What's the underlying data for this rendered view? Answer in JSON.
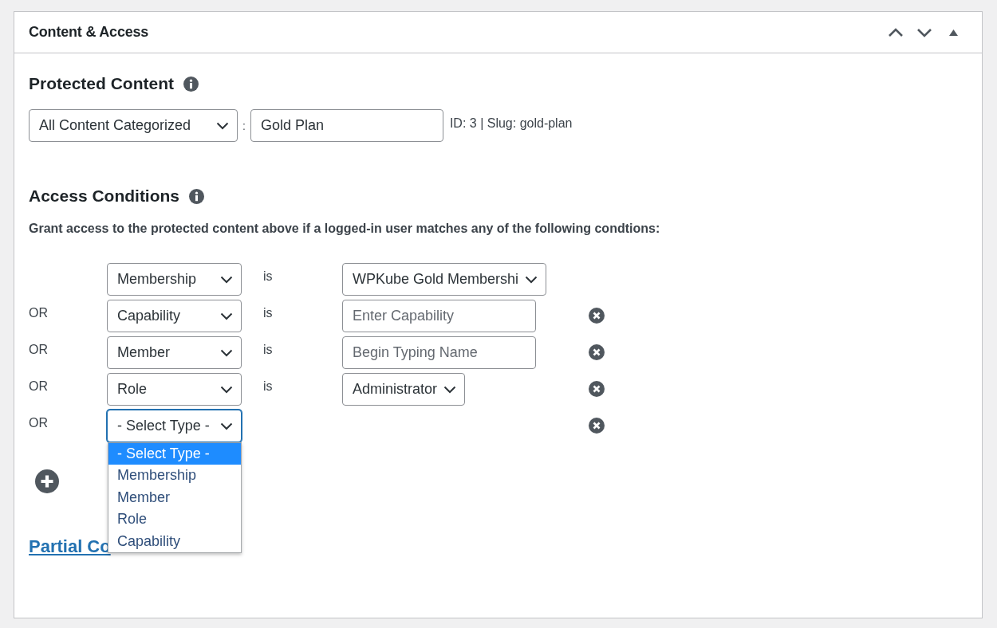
{
  "panel": {
    "title": "Content & Access"
  },
  "protected": {
    "heading": "Protected Content",
    "content_type": "All Content Categorized",
    "separator": ":",
    "term": "Gold Plan",
    "meta": "ID: 3 | Slug: gold-plan"
  },
  "access": {
    "heading": "Access Conditions",
    "description": "Grant access to the protected content above if a logged-in user matches any of the following condtions:",
    "rows": [
      {
        "connector": "",
        "type": "Membership",
        "operator": "is",
        "value": {
          "kind": "select",
          "text": "WPKube Gold Membershi"
        },
        "removable": false,
        "focused": false
      },
      {
        "connector": "OR",
        "type": "Capability",
        "operator": "is",
        "value": {
          "kind": "input",
          "placeholder": "Enter Capability"
        },
        "removable": true,
        "focused": false
      },
      {
        "connector": "OR",
        "type": "Member",
        "operator": "is",
        "value": {
          "kind": "input",
          "placeholder": "Begin Typing Name"
        },
        "removable": true,
        "focused": false
      },
      {
        "connector": "OR",
        "type": "Role",
        "operator": "is",
        "value": {
          "kind": "select",
          "text": "Administrator"
        },
        "removable": true,
        "focused": false
      },
      {
        "connector": "OR",
        "type": "- Select Type -",
        "removable": true,
        "focused": true,
        "options": [
          {
            "label": "- Select Type -",
            "selected": true
          },
          {
            "label": "Membership",
            "selected": false
          },
          {
            "label": "Member",
            "selected": false
          },
          {
            "label": "Role",
            "selected": false
          },
          {
            "label": "Capability",
            "selected": false
          }
        ]
      }
    ]
  },
  "link": {
    "text": "Partial Co"
  }
}
